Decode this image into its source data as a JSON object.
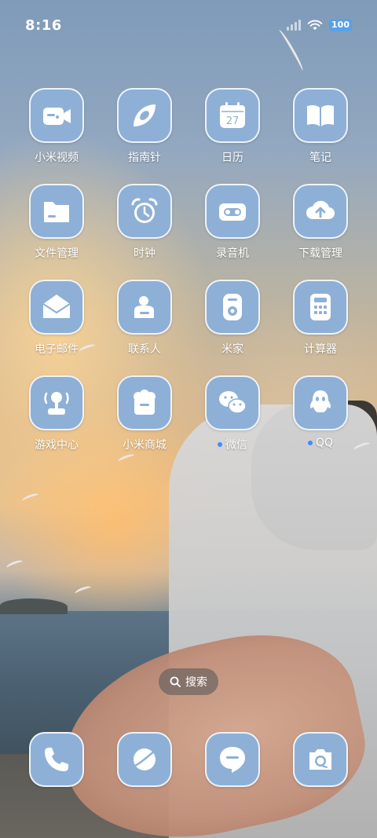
{
  "status_bar": {
    "time": "8:16",
    "battery": "100"
  },
  "apps": [
    {
      "label": "小米视频",
      "icon": "video-camera-icon",
      "name": "app-mi-video"
    },
    {
      "label": "指南针",
      "icon": "compass-icon",
      "name": "app-compass"
    },
    {
      "label": "日历",
      "icon": "calendar-icon",
      "name": "app-calendar",
      "icon_text": "27"
    },
    {
      "label": "笔记",
      "icon": "notes-book-icon",
      "name": "app-notes"
    },
    {
      "label": "文件管理",
      "icon": "folder-icon",
      "name": "app-file-manager"
    },
    {
      "label": "时钟",
      "icon": "alarm-clock-icon",
      "name": "app-clock"
    },
    {
      "label": "录音机",
      "icon": "cassette-icon",
      "name": "app-recorder"
    },
    {
      "label": "下载管理",
      "icon": "cloud-download-icon",
      "name": "app-downloads"
    },
    {
      "label": "电子邮件",
      "icon": "envelope-icon",
      "name": "app-email"
    },
    {
      "label": "联系人",
      "icon": "contact-card-icon",
      "name": "app-contacts"
    },
    {
      "label": "米家",
      "icon": "smart-device-icon",
      "name": "app-mijia"
    },
    {
      "label": "计算器",
      "icon": "calculator-icon",
      "name": "app-calculator"
    },
    {
      "label": "游戏中心",
      "icon": "joystick-icon",
      "name": "app-game-center"
    },
    {
      "label": "小米商城",
      "icon": "shopping-bag-icon",
      "name": "app-mi-store"
    },
    {
      "label": "微信",
      "icon": "wechat-icon",
      "name": "app-wechat",
      "notification_dot": true
    },
    {
      "label": "QQ",
      "icon": "qq-penguin-icon",
      "name": "app-qq",
      "notification_dot": true
    }
  ],
  "search": {
    "label": "搜索"
  },
  "dock": [
    {
      "icon": "phone-icon",
      "name": "dock-phone"
    },
    {
      "icon": "browser-planet-icon",
      "name": "dock-browser"
    },
    {
      "icon": "message-bubble-icon",
      "name": "dock-messages"
    },
    {
      "icon": "camera-icon",
      "name": "dock-camera"
    }
  ],
  "colors": {
    "icon_bg": "#8eb0d6",
    "notification_dot": "#3f8cff",
    "battery": "#5aa0e6"
  }
}
